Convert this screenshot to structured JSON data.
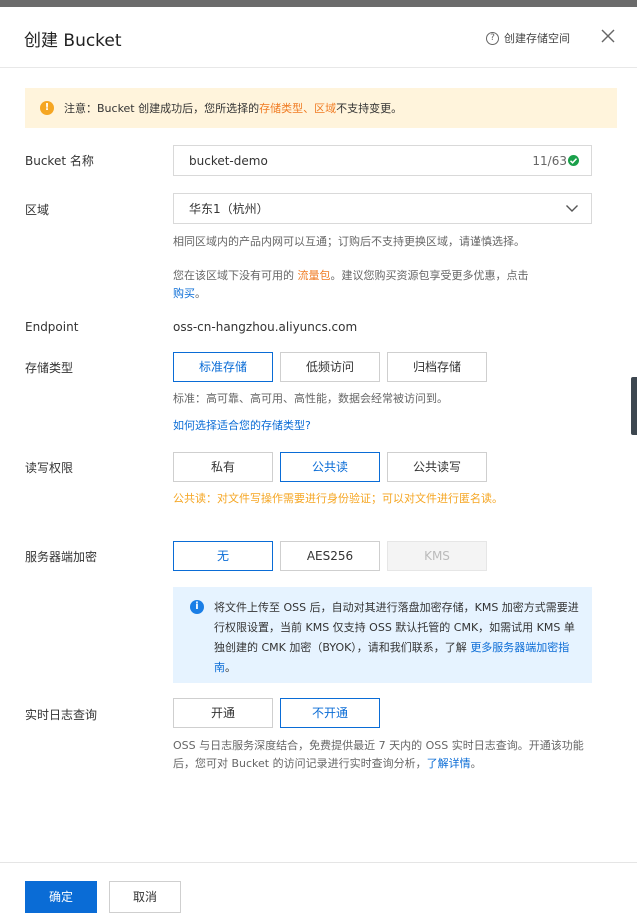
{
  "header": {
    "title": "创建 Bucket",
    "help_label": "创建存储空间"
  },
  "notice": {
    "prefix": "注意：Bucket 创建成功后，您所选择的 ",
    "highlight": "存储类型、区域",
    "suffix": " 不支持变更。"
  },
  "bucket_name": {
    "label": "Bucket 名称",
    "value": "bucket-demo",
    "count": "11/63"
  },
  "region": {
    "label": "区域",
    "value": "华东1（杭州）",
    "hint1": "相同区域内的产品内网可以互通；订购后不支持更换区域，请谨慎选择。",
    "hint2_prefix": "您在该区域下没有可用的 ",
    "hint2_highlight": "流量包",
    "hint2_suffix": "。建议您购买资源包享受更多优惠，点击",
    "hint2_link": "购买",
    "hint2_end": "。"
  },
  "endpoint": {
    "label": "Endpoint",
    "value": "oss-cn-hangzhou.aliyuncs.com"
  },
  "storage_class": {
    "label": "存储类型",
    "options": [
      "标准存储",
      "低频访问",
      "归档存储"
    ],
    "selected": "标准存储",
    "desc": "标准：高可靠、高可用、高性能，数据会经常被访问到。",
    "link": "如何选择适合您的存储类型?"
  },
  "acl": {
    "label": "读写权限",
    "options": [
      "私有",
      "公共读",
      "公共读写"
    ],
    "selected": "公共读",
    "warning": "公共读：对文件写操作需要进行身份验证；可以对文件进行匿名读。"
  },
  "encryption": {
    "label": "服务器端加密",
    "options": [
      "无",
      "AES256",
      "KMS"
    ],
    "selected": "无",
    "disabled": "KMS",
    "info_text": "将文件上传至 OSS 后，自动对其进行落盘加密存储，KMS 加密方式需要进行权限设置，当前 KMS 仅支持 OSS 默认托管的 CMK，如需试用 KMS 单独创建的 CMK 加密（BYOK），请和我们联系，了解 ",
    "info_link": "更多服务器端加密指南",
    "info_end": "。"
  },
  "realtime_log": {
    "label": "实时日志查询",
    "options": [
      "开通",
      "不开通"
    ],
    "selected": "不开通",
    "desc": "OSS 与日志服务深度结合，免费提供最近 7 天内的 OSS 实时日志查询。开通该功能后，您可对 Bucket 的访问记录进行实时查询分析，",
    "link": "了解详情",
    "end": "。"
  },
  "footer": {
    "confirm": "确定",
    "cancel": "取消"
  },
  "colors": {
    "accent": "#0a6cd6",
    "warning": "#f5a623",
    "notice_bg": "#fff4dc",
    "info_bg": "#e6f3ff"
  }
}
